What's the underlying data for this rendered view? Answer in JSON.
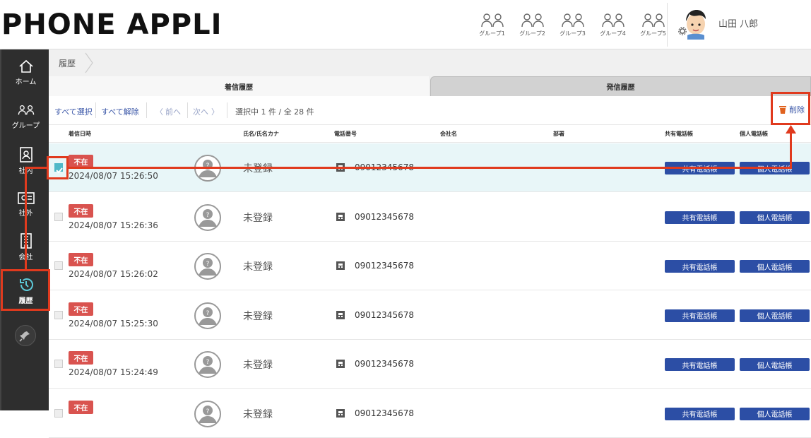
{
  "app": {
    "title": "PHONE APPLI"
  },
  "groups": [
    {
      "label": "グループ1"
    },
    {
      "label": "グループ2"
    },
    {
      "label": "グループ3"
    },
    {
      "label": "グループ4"
    },
    {
      "label": "グループ5"
    }
  ],
  "user": {
    "name": "山田 八郎"
  },
  "sidebar": {
    "items": [
      {
        "label": "ホーム",
        "icon": "home-icon"
      },
      {
        "label": "グループ",
        "icon": "group-icon"
      },
      {
        "label": "社内",
        "icon": "contact-card-icon"
      },
      {
        "label": "社外",
        "icon": "business-card-icon"
      },
      {
        "label": "会社",
        "icon": "building-icon"
      },
      {
        "label": "履歴",
        "icon": "history-icon",
        "active": true
      }
    ]
  },
  "breadcrumb": {
    "label": "履歴"
  },
  "tabs": [
    {
      "label": "着信履歴"
    },
    {
      "label": "発信履歴",
      "active": true
    }
  ],
  "toolbar": {
    "select_all": "すべて選択",
    "deselect_all": "すべて解除",
    "prev": "前へ",
    "next": "次へ",
    "status": "選択中 1 件 / 全 28 件",
    "delete_label": "削除"
  },
  "columns": {
    "datetime": "着信日時",
    "name": "氏名/氏名カナ",
    "phone": "電話番号",
    "company": "会社名",
    "department": "部署",
    "shared_book": "共有電話帳",
    "personal_book": "個人電話帳"
  },
  "rows": [
    {
      "status": "不在",
      "datetime": "2024/08/07 15:26:50",
      "name": "未登録",
      "phone": "09012345678",
      "shared": "共有電話帳",
      "personal": "個人電話帳",
      "selected": true
    },
    {
      "status": "不在",
      "datetime": "2024/08/07 15:26:36",
      "name": "未登録",
      "phone": "09012345678",
      "shared": "共有電話帳",
      "personal": "個人電話帳"
    },
    {
      "status": "不在",
      "datetime": "2024/08/07 15:26:02",
      "name": "未登録",
      "phone": "09012345678",
      "shared": "共有電話帳",
      "personal": "個人電話帳"
    },
    {
      "status": "不在",
      "datetime": "2024/08/07 15:25:30",
      "name": "未登録",
      "phone": "09012345678",
      "shared": "共有電話帳",
      "personal": "個人電話帳"
    },
    {
      "status": "不在",
      "datetime": "2024/08/07 15:24:49",
      "name": "未登録",
      "phone": "09012345678",
      "shared": "共有電話帳",
      "personal": "個人電話帳"
    },
    {
      "status": "不在",
      "datetime": "",
      "name": "未登録",
      "phone": "09012345678",
      "shared": "共有電話帳",
      "personal": "個人電話帳"
    }
  ],
  "colors": {
    "accent": "#2c4ea5",
    "badge": "#d9534f",
    "sidebar": "#2e2e2e",
    "highlight": "#e03a1e",
    "selected_row": "#e8f6f8"
  }
}
